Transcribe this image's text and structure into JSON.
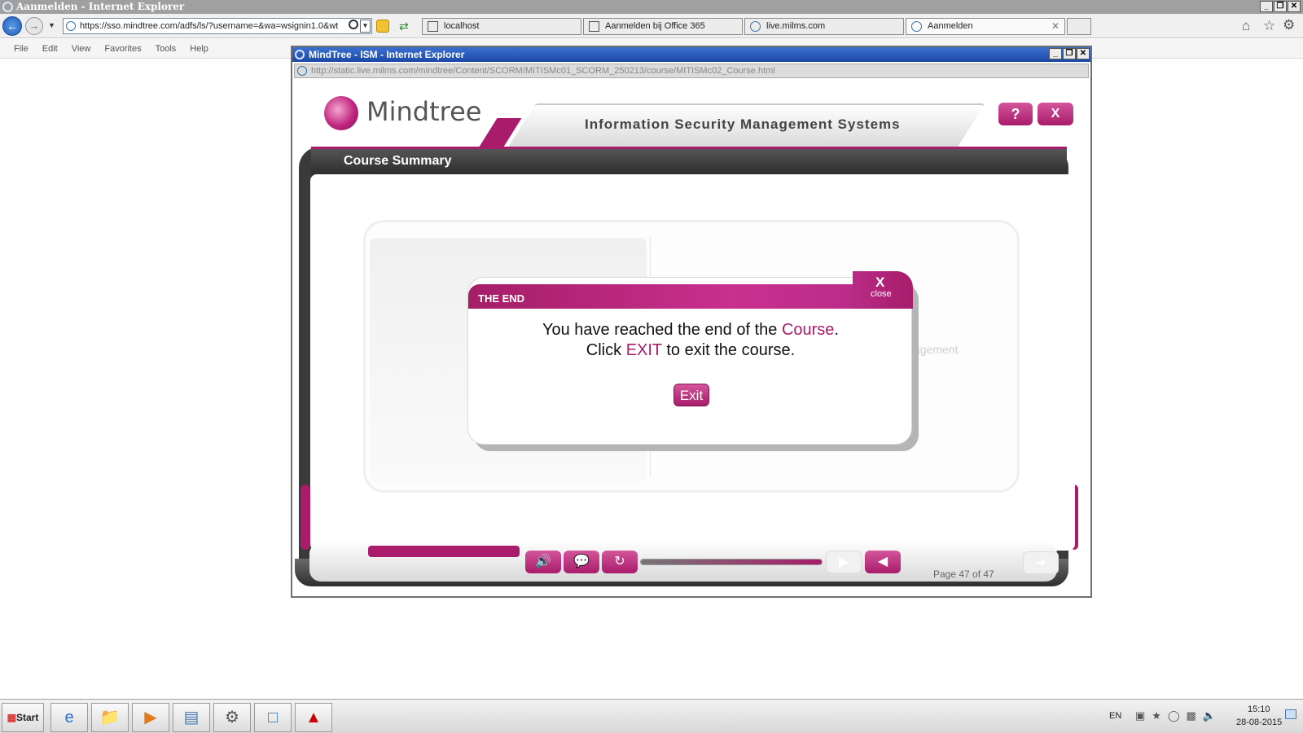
{
  "ie": {
    "title": "Aanmelden - Internet Explorer",
    "address": "https://sso.mindtree.com/adfs/ls/?username=&wa=wsignin1.0&wt",
    "tabs": [
      {
        "label": "localhost"
      },
      {
        "label": "Aanmelden bij Office 365"
      },
      {
        "label": "live.milms.com"
      },
      {
        "label": "Aanmelden",
        "active": true
      }
    ],
    "menu": [
      "File",
      "Edit",
      "View",
      "Favorites",
      "Tools",
      "Help"
    ],
    "window_controls": {
      "minimize": "_",
      "restore": "❐",
      "close": "✕"
    }
  },
  "popup": {
    "title": "MindTree - ISM - Internet Explorer",
    "url": "http://static.live.milms.com/mindtree/Content/SCORM/MITISMc01_SCORM_250213/course/MITISMc02_Course.html"
  },
  "course": {
    "logo_text": "Mindtree",
    "header_title": "Information Security Management Systems",
    "help_label": "?",
    "close_label": "X",
    "section_title": "Course Summary",
    "faded_text": "agement",
    "page_indicator": "Page 47 of 47",
    "progress": 1.0
  },
  "modal": {
    "title": "THE END",
    "close_x": "X",
    "close_label": "close",
    "line1_pre": "You have reached the end of the ",
    "line1_highlight": "Course",
    "line1_post": ".",
    "line2_pre": "Click ",
    "line2_highlight": "EXIT",
    "line2_post": " to exit the course.",
    "exit_label": "Exit"
  },
  "taskbar": {
    "start_label": "Start",
    "apps": [
      "ie-icon",
      "folder-icon",
      "media-player-icon",
      "notepad-icon",
      "settings-icon",
      "app-icon",
      "pdf-icon"
    ],
    "lang": "EN",
    "time": "15:10",
    "date": "28-08-2015"
  },
  "colors": {
    "accent": "#a81c6b",
    "accent_light": "#d4559b",
    "dark_frame": "#3a3a3a"
  }
}
